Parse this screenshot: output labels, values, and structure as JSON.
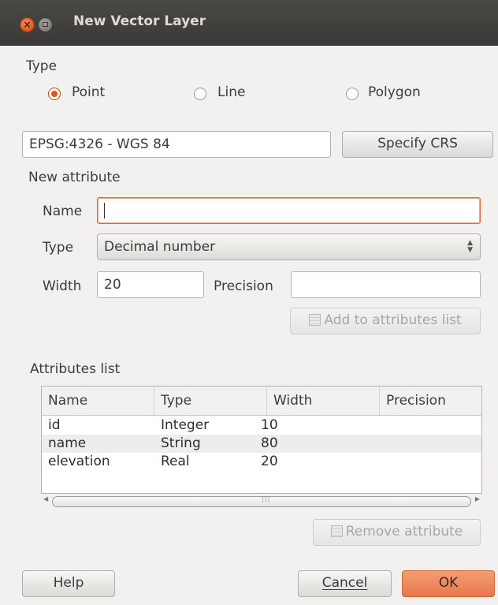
{
  "window": {
    "title": "New Vector Layer"
  },
  "type_section": {
    "label": "Type",
    "options": [
      {
        "label": "Point",
        "selected": true
      },
      {
        "label": "Line",
        "selected": false
      },
      {
        "label": "Polygon",
        "selected": false
      }
    ]
  },
  "crs": {
    "value": "EPSG:4326 - WGS 84",
    "button": "Specify CRS"
  },
  "new_attribute": {
    "label": "New attribute",
    "name_label": "Name",
    "name_value": "",
    "type_label": "Type",
    "type_value": "Decimal number",
    "width_label": "Width",
    "width_value": "20",
    "precision_label": "Precision",
    "precision_value": "",
    "add_button": "Add to attributes list"
  },
  "attributes_list": {
    "label": "Attributes list",
    "columns": [
      "Name",
      "Type",
      "Width",
      "Precision"
    ],
    "rows": [
      {
        "name": "id",
        "type": "Integer",
        "width": "10",
        "precision": ""
      },
      {
        "name": "name",
        "type": "String",
        "width": "80",
        "precision": ""
      },
      {
        "name": "elevation",
        "type": "Real",
        "width": "20",
        "precision": ""
      }
    ],
    "remove_button": "Remove attribute"
  },
  "footer": {
    "help": "Help",
    "cancel": "Cancel",
    "ok": "OK"
  },
  "colors": {
    "accent": "#e0541b",
    "ok_button": "#e8784b",
    "titlebar": "#3c3b37"
  }
}
